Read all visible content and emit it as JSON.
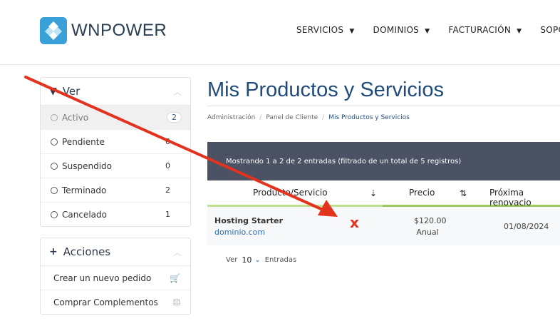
{
  "header": {
    "logo_text": "WNPOWER",
    "nav": [
      {
        "label": "SERVICIOS"
      },
      {
        "label": "DOMINIOS"
      },
      {
        "label": "FACTURACIÓN"
      },
      {
        "label": "SOPO"
      }
    ]
  },
  "sidebar": {
    "view_panel": {
      "title": "Ver",
      "filters": [
        {
          "label": "Activo",
          "count": "2"
        },
        {
          "label": "Pendiente",
          "count": "0"
        },
        {
          "label": "Suspendido",
          "count": "0"
        },
        {
          "label": "Terminado",
          "count": "2"
        },
        {
          "label": "Cancelado",
          "count": "1"
        }
      ]
    },
    "actions_panel": {
      "title": "Acciones",
      "items": [
        {
          "label": "Crear un nuevo pedido"
        },
        {
          "label": "Comprar Complementos"
        }
      ]
    }
  },
  "main": {
    "title": "Mis Productos y Servicios",
    "breadcrumb": [
      "Administración",
      "Panel de Cliente",
      "Mis Productos y Servicios"
    ],
    "info": "Mostrando 1 a 2 de 2 entradas (filtrado de un total de 5 registros)",
    "columns": [
      "Producto/Servicio",
      "Precio",
      "Próxima renovacio"
    ],
    "rows": [
      {
        "product": "Hosting Starter",
        "domain": "dominio.com",
        "price": "$120.00",
        "cycle": "Anual",
        "next_due": "01/08/2024"
      }
    ],
    "pager": {
      "show_label": "Ver",
      "per_page": "10",
      "entries_label": "Entradas"
    }
  },
  "annotation": {
    "mark": "x",
    "color": "#e3321e"
  }
}
